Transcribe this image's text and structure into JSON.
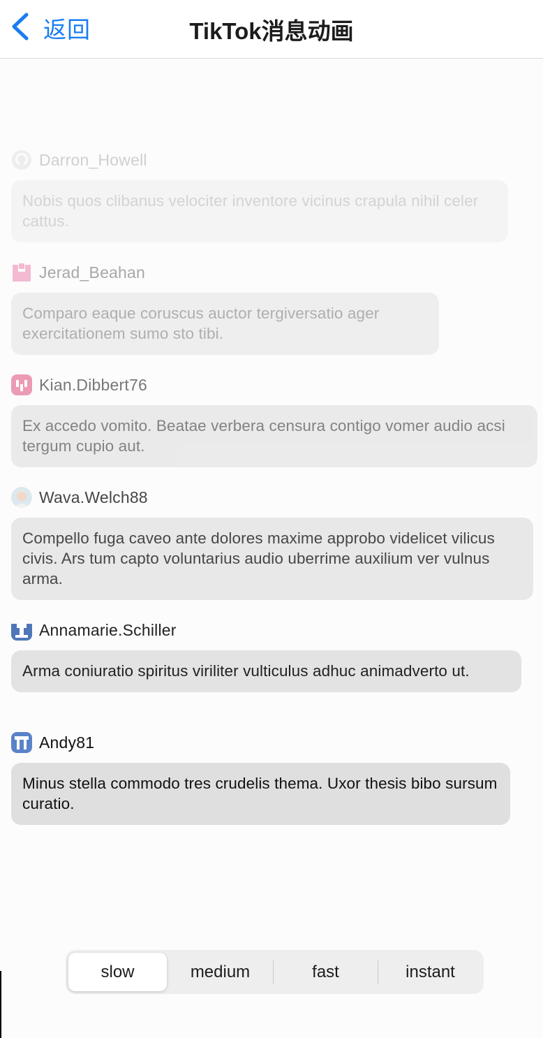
{
  "nav": {
    "back_label": "返回",
    "title": "TikTok消息动画"
  },
  "colors": {
    "accent": "#1a7cf3"
  },
  "messages": [
    {
      "username": "Darron_Howell",
      "avatar": "github-octocat-icon",
      "text": "Nobis quos clibanus velociter inventore vicinus crapula nihil celer cattus."
    },
    {
      "username": "Jerad_Beahan",
      "avatar": "pink-identicon",
      "text": "Comparo eaque coruscus auctor tergiversatio ager exercitationem sumo sto tibi."
    },
    {
      "username": "Kian.Dibbert76",
      "avatar": "pink-identicon",
      "text": "Ex accedo vomito. Beatae verbera censura contigo vomer audio acsi tergum cupio aut."
    },
    {
      "username": "Wava.Welch88",
      "avatar": "person-avatar",
      "text": "Compello fuga caveo ante dolores maxime approbo videlicet vilicus civis. Ars tum capto voluntarius audio uberrime auxilium ver vulnus arma."
    },
    {
      "username": "Annamarie.Schiller",
      "avatar": "blue-identicon",
      "text": "Arma coniuratio spiritus viriliter vulticulus adhuc animadverto ut."
    },
    {
      "username": "Andy81",
      "avatar": "blue-identicon",
      "text": "Minus stella commodo tres crudelis thema. Uxor thesis bibo sursum curatio."
    }
  ],
  "speed_control": {
    "options": [
      "slow",
      "medium",
      "fast",
      "instant"
    ],
    "selected": "slow"
  }
}
